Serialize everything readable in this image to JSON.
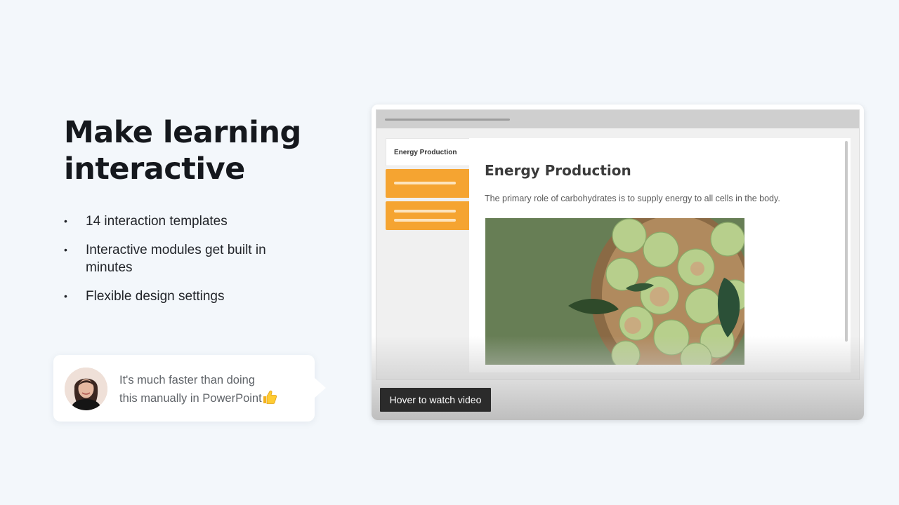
{
  "headline": {
    "line1": "Make learning",
    "line2": "interactive"
  },
  "features": [
    {
      "bullet": "•",
      "text": "14 interaction templates"
    },
    {
      "bullet": "•",
      "text": "Interactive modules get built in minutes"
    },
    {
      "bullet": "•",
      "text": "Flexible design settings"
    }
  ],
  "testimonial": {
    "line1": "It's much faster than doing",
    "line2": "this manually in PowerPoint",
    "emoji_icon": "thumbs-up-icon"
  },
  "video_preview": {
    "nav_tab_label": "Energy Production",
    "content_title": "Energy Production",
    "content_body": "The primary role of carbohydrates is to supply energy to all cells in the body.",
    "image_subject": "green-apples-in-basket",
    "accent_color": "#f5a431",
    "hover_button_label": "Hover to watch video"
  }
}
